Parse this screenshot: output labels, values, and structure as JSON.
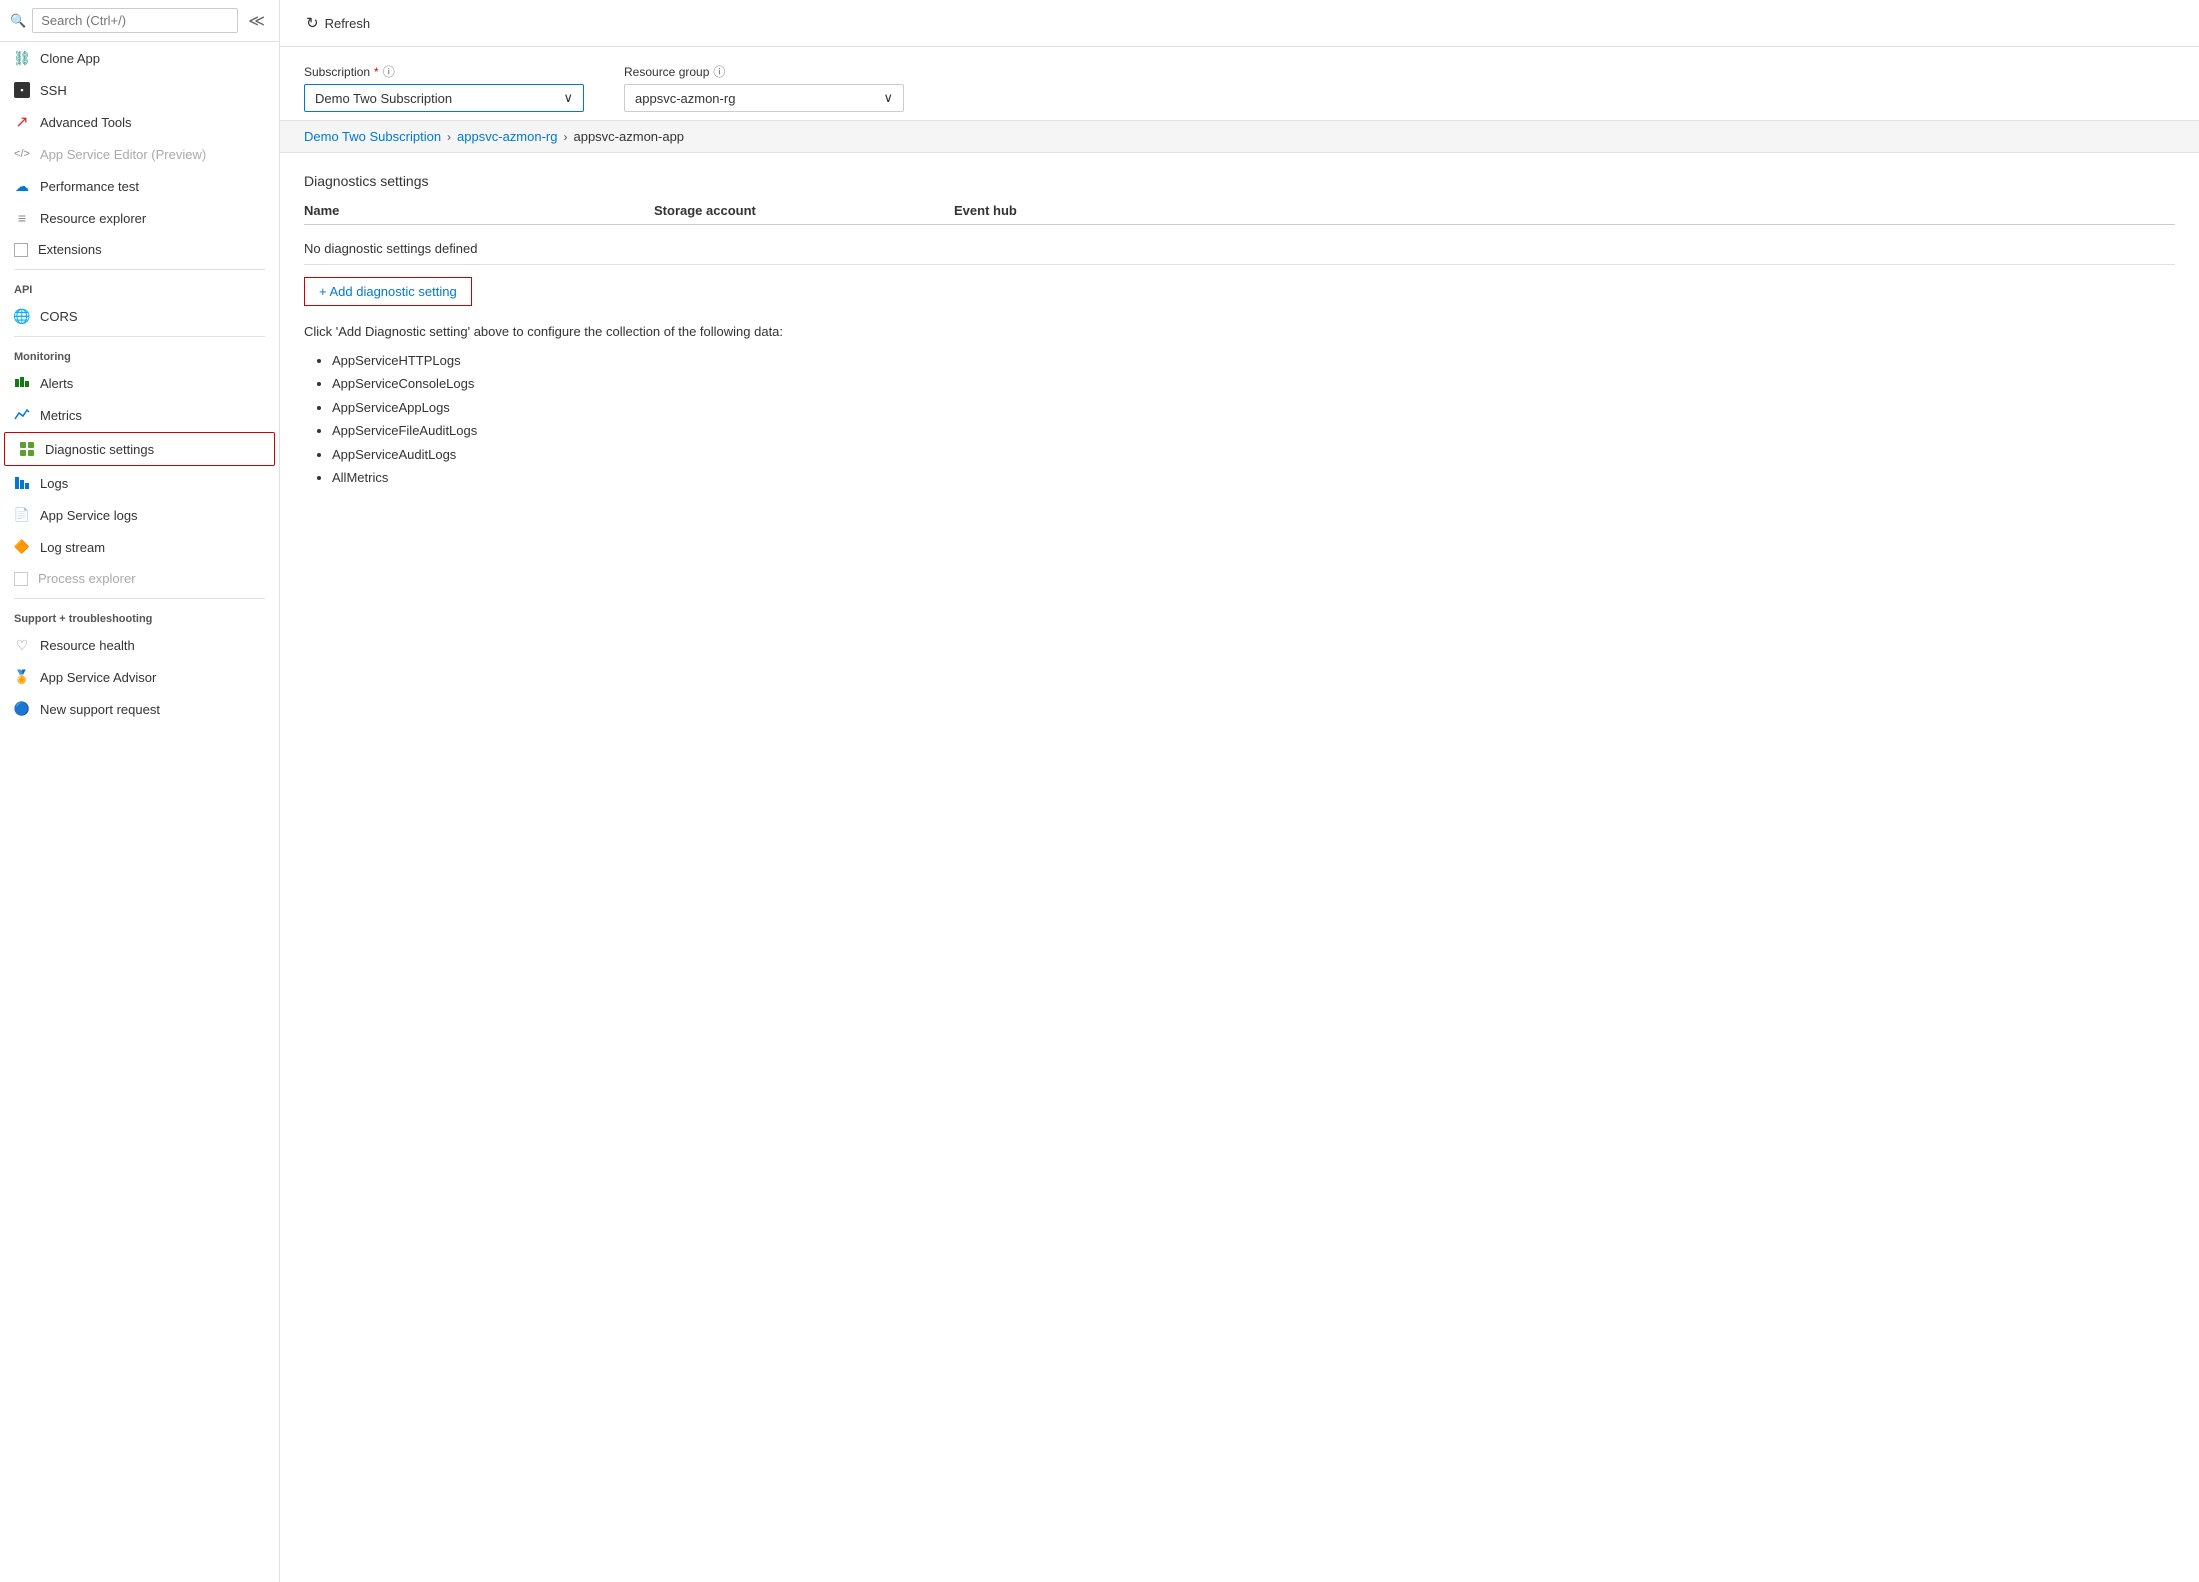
{
  "sidebar": {
    "search_placeholder": "Search (Ctrl+/)",
    "items": [
      {
        "id": "clone-app",
        "label": "Clone App",
        "icon": "🔗",
        "icon_color": "icon-teal",
        "disabled": false,
        "section": null
      },
      {
        "id": "ssh",
        "label": "SSH",
        "icon": "▪",
        "icon_color": "icon-gray",
        "disabled": false,
        "section": null
      },
      {
        "id": "advanced-tools",
        "label": "Advanced Tools",
        "icon": "↗",
        "icon_color": "icon-red",
        "disabled": false,
        "section": null
      },
      {
        "id": "app-service-editor",
        "label": "App Service Editor (Preview)",
        "icon": "</>",
        "icon_color": "icon-gray",
        "disabled": true,
        "section": null
      },
      {
        "id": "performance-test",
        "label": "Performance test",
        "icon": "☁",
        "icon_color": "icon-blue",
        "disabled": false,
        "section": null
      },
      {
        "id": "resource-explorer",
        "label": "Resource explorer",
        "icon": "≡",
        "icon_color": "icon-gray",
        "disabled": false,
        "section": null
      },
      {
        "id": "extensions",
        "label": "Extensions",
        "icon": "⬜",
        "icon_color": "icon-gray",
        "disabled": false,
        "section": null
      },
      {
        "id": "api-section",
        "label": "API",
        "type": "section"
      },
      {
        "id": "cors",
        "label": "CORS",
        "icon": "🌐",
        "icon_color": "icon-green",
        "disabled": false,
        "section": "API"
      },
      {
        "id": "monitoring-section",
        "label": "Monitoring",
        "type": "section"
      },
      {
        "id": "alerts",
        "label": "Alerts",
        "icon": "📊",
        "icon_color": "icon-green",
        "disabled": false,
        "section": "Monitoring"
      },
      {
        "id": "metrics",
        "label": "Metrics",
        "icon": "📈",
        "icon_color": "icon-blue",
        "disabled": false,
        "section": "Monitoring"
      },
      {
        "id": "diagnostic-settings",
        "label": "Diagnostic settings",
        "icon": "📋",
        "icon_color": "icon-lime",
        "disabled": false,
        "section": "Monitoring",
        "active": true
      },
      {
        "id": "logs",
        "label": "Logs",
        "icon": "📊",
        "icon_color": "icon-blue",
        "disabled": false,
        "section": "Monitoring"
      },
      {
        "id": "app-service-logs",
        "label": "App Service logs",
        "icon": "📄",
        "icon_color": "icon-purple",
        "disabled": false,
        "section": "Monitoring"
      },
      {
        "id": "log-stream",
        "label": "Log stream",
        "icon": "🔶",
        "icon_color": "icon-orange",
        "disabled": false,
        "section": "Monitoring"
      },
      {
        "id": "process-explorer",
        "label": "Process explorer",
        "icon": "⬜",
        "icon_color": "icon-gray",
        "disabled": true,
        "section": "Monitoring"
      },
      {
        "id": "support-section",
        "label": "Support + troubleshooting",
        "type": "section"
      },
      {
        "id": "resource-health",
        "label": "Resource health",
        "icon": "♡",
        "icon_color": "icon-gray",
        "disabled": false,
        "section": "Support"
      },
      {
        "id": "app-service-advisor",
        "label": "App Service Advisor",
        "icon": "🏅",
        "icon_color": "icon-blue",
        "disabled": false,
        "section": "Support"
      },
      {
        "id": "new-support-request",
        "label": "New support request",
        "icon": "🔵",
        "icon_color": "icon-blue",
        "disabled": false,
        "section": "Support"
      }
    ]
  },
  "toolbar": {
    "refresh_label": "Refresh"
  },
  "subscription": {
    "label": "Subscription",
    "required": true,
    "value": "Demo Two Subscription",
    "info_icon": "ⓘ"
  },
  "resource_group": {
    "label": "Resource group",
    "value": "appsvc-azmon-rg",
    "info_icon": "ⓘ"
  },
  "breadcrumb": {
    "items": [
      {
        "label": "Demo Two Subscription",
        "link": true
      },
      {
        "label": "appsvc-azmon-rg",
        "link": true
      },
      {
        "label": "appsvc-azmon-app",
        "link": false
      }
    ]
  },
  "diagnostics": {
    "title": "Diagnostics settings",
    "columns": {
      "name": "Name",
      "storage_account": "Storage account",
      "event_hub": "Event hub"
    },
    "empty_message": "No diagnostic settings defined",
    "add_button_label": "+ Add diagnostic setting",
    "info_text": "Click 'Add Diagnostic setting' above to configure the collection of the following data:",
    "data_types": [
      "AppServiceHTTPLogs",
      "AppServiceConsoleLogs",
      "AppServiceAppLogs",
      "AppServiceFileAuditLogs",
      "AppServiceAuditLogs",
      "AllMetrics"
    ]
  }
}
